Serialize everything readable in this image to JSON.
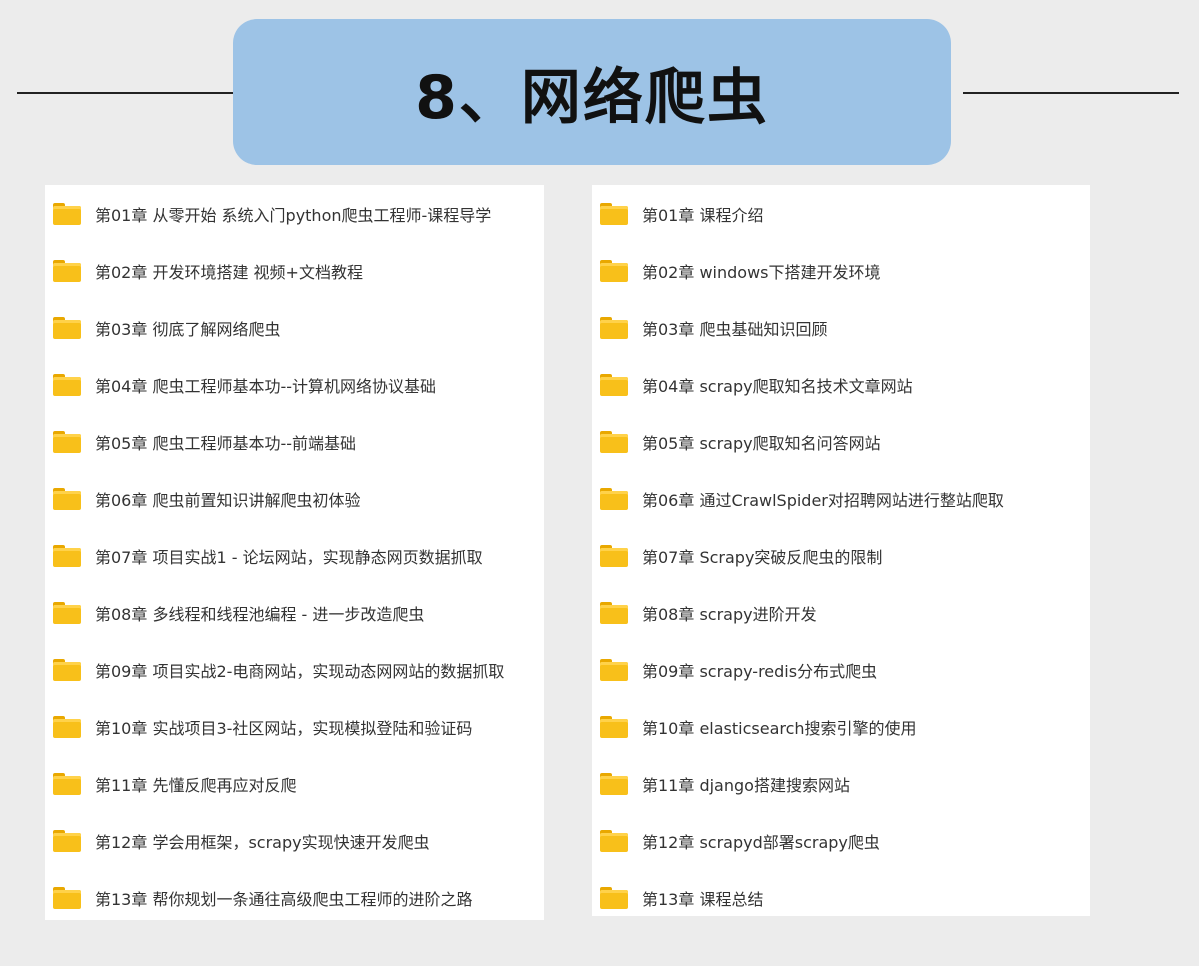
{
  "banner": {
    "title": "8、网络爬虫"
  },
  "left_panel": {
    "items": [
      {
        "label": "第01章 从零开始 系统入门python爬虫工程师-课程导学"
      },
      {
        "label": "第02章 开发环境搭建 视频+文档教程"
      },
      {
        "label": "第03章 彻底了解网络爬虫"
      },
      {
        "label": "第04章 爬虫工程师基本功--计算机网络协议基础"
      },
      {
        "label": "第05章 爬虫工程师基本功--前端基础"
      },
      {
        "label": "第06章 爬虫前置知识讲解爬虫初体验"
      },
      {
        "label": "第07章 项目实战1 - 论坛网站，实现静态网页数据抓取"
      },
      {
        "label": "第08章 多线程和线程池编程 - 进一步改造爬虫"
      },
      {
        "label": "第09章 项目实战2-电商网站，实现动态网网站的数据抓取"
      },
      {
        "label": "第10章 实战项目3-社区网站，实现模拟登陆和验证码"
      },
      {
        "label": "第11章 先懂反爬再应对反爬"
      },
      {
        "label": "第12章 学会用框架，scrapy实现快速开发爬虫"
      },
      {
        "label": "第13章 帮你规划一条通往高级爬虫工程师的进阶之路"
      }
    ]
  },
  "right_panel": {
    "items": [
      {
        "label": "第01章 课程介绍"
      },
      {
        "label": "第02章 windows下搭建开发环境"
      },
      {
        "label": "第03章 爬虫基础知识回顾"
      },
      {
        "label": "第04章  scrapy爬取知名技术文章网站"
      },
      {
        "label": "第05章 scrapy爬取知名问答网站"
      },
      {
        "label": "第06章 通过CrawlSpider对招聘网站进行整站爬取"
      },
      {
        "label": "第07章 Scrapy突破反爬虫的限制"
      },
      {
        "label": "第08章 scrapy进阶开发"
      },
      {
        "label": "第09章 scrapy-redis分布式爬虫"
      },
      {
        "label": "第10章 elasticsearch搜索引擎的使用"
      },
      {
        "label": "第11章  django搭建搜索网站"
      },
      {
        "label": "第12章 scrapyd部署scrapy爬虫"
      },
      {
        "label": "第13章 课程总结"
      }
    ]
  },
  "icons": {
    "item_icon": "folder-icon",
    "folder_color": "#f8c01a"
  },
  "colors": {
    "banner_background": "#9dc3e6",
    "page_background": "#ececec"
  }
}
